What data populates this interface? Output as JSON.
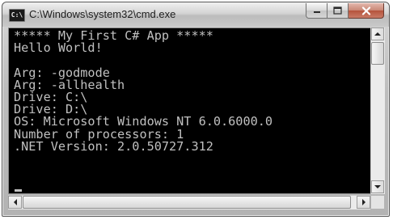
{
  "window": {
    "title": "C:\\Windows\\system32\\cmd.exe",
    "icon": "cmd-icon",
    "icon_text": "C:\\"
  },
  "caption_buttons": {
    "minimize": "minimize-icon",
    "maximize": "maximize-icon",
    "close": "close-icon"
  },
  "console": {
    "lines": [
      "***** My First C# App *****",
      "Hello World!",
      "",
      "Arg: -godmode",
      "Arg: -allhealth",
      "Drive: C:\\",
      "Drive: D:\\",
      "OS: Microsoft Windows NT 6.0.6000.0",
      "Number of processors: 1",
      ".NET Version: 2.0.50727.312"
    ],
    "colors": {
      "background": "#000000",
      "foreground": "#c0c0c0"
    }
  },
  "scrollbars": {
    "vertical_position": 0.0,
    "horizontal_position": 0.0
  }
}
